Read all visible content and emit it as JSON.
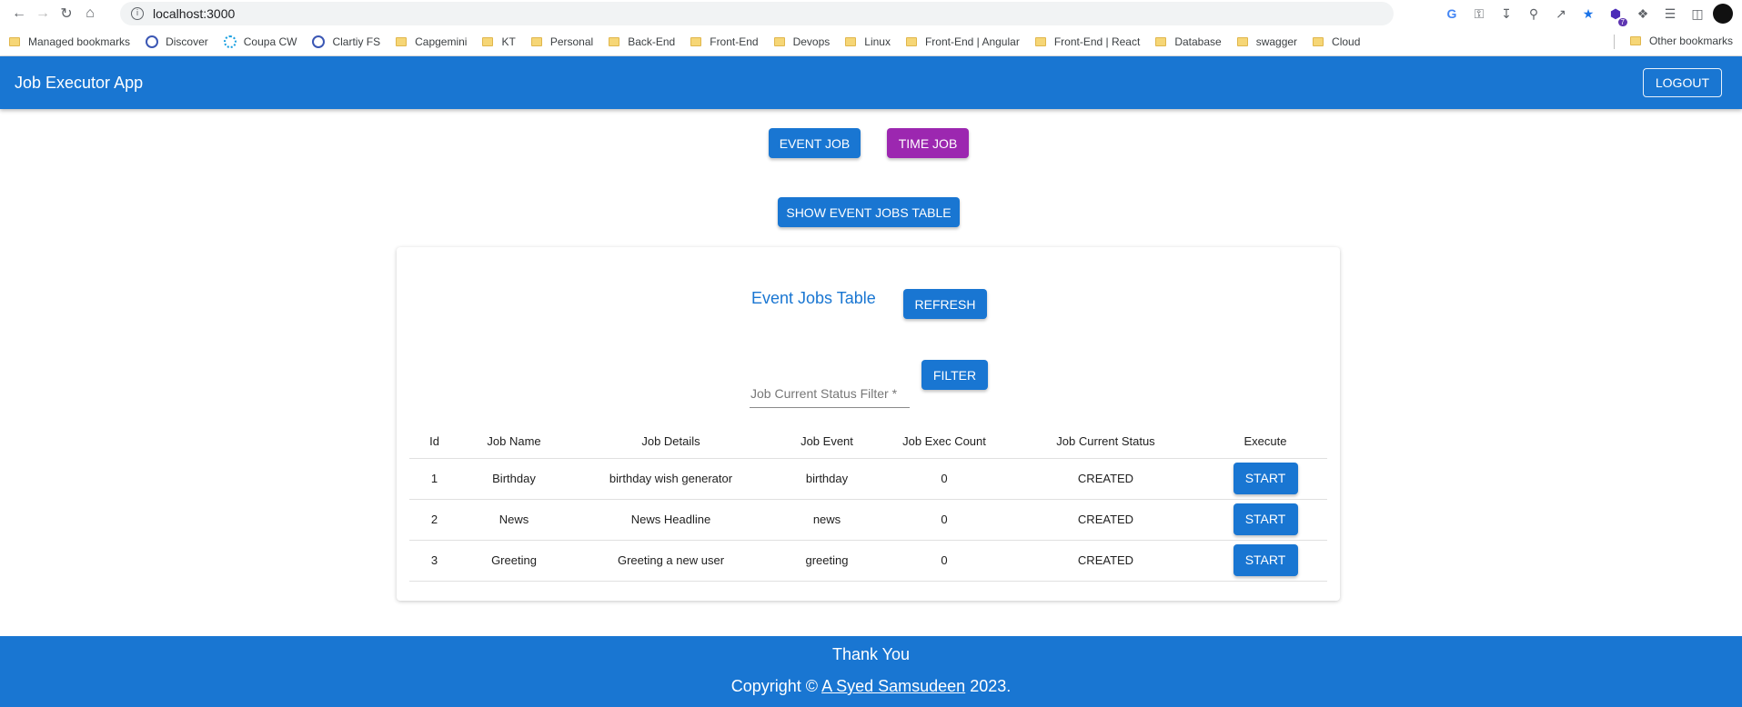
{
  "browser": {
    "url": "localhost:3000",
    "extension_badge": "7",
    "bookmarks": [
      {
        "label": "Managed bookmarks",
        "icon": "folder"
      },
      {
        "label": "Discover",
        "icon": "discover-icon"
      },
      {
        "label": "Coupa CW",
        "icon": "coupa-icon"
      },
      {
        "label": "Clartiy FS",
        "icon": "clarity-icon"
      },
      {
        "label": "Capgemini",
        "icon": "folder"
      },
      {
        "label": "KT",
        "icon": "folder"
      },
      {
        "label": "Personal",
        "icon": "folder"
      },
      {
        "label": "Back-End",
        "icon": "folder"
      },
      {
        "label": "Front-End",
        "icon": "folder"
      },
      {
        "label": "Devops",
        "icon": "folder"
      },
      {
        "label": "Linux",
        "icon": "folder"
      },
      {
        "label": "Front-End | Angular",
        "icon": "folder"
      },
      {
        "label": "Front-End | React",
        "icon": "folder"
      },
      {
        "label": "Database",
        "icon": "folder"
      },
      {
        "label": "swagger",
        "icon": "folder"
      },
      {
        "label": "Cloud",
        "icon": "folder"
      }
    ],
    "other_bookmarks": "Other bookmarks"
  },
  "app": {
    "title": "Job Executor App",
    "logout_label": "LOGOUT",
    "primary_color": "#1976d2",
    "secondary_color": "#9c27b0"
  },
  "actions": {
    "event_job_label": "EVENT JOB",
    "time_job_label": "TIME JOB",
    "show_table_label": "SHOW EVENT JOBS TABLE"
  },
  "card": {
    "title": "Event Jobs Table",
    "refresh_label": "REFRESH",
    "filter_label": "Job Current Status Filter *",
    "filter_button_label": "FILTER"
  },
  "table": {
    "headers": [
      "Id",
      "Job Name",
      "Job Details",
      "Job Event",
      "Job Exec Count",
      "Job Current Status",
      "Execute"
    ],
    "rows": [
      {
        "id": "1",
        "name": "Birthday",
        "details": "birthday wish generator",
        "event": "birthday",
        "count": "0",
        "status": "CREATED",
        "action": "START"
      },
      {
        "id": "2",
        "name": "News",
        "details": "News Headline",
        "event": "news",
        "count": "0",
        "status": "CREATED",
        "action": "START"
      },
      {
        "id": "3",
        "name": "Greeting",
        "details": "Greeting a new user",
        "event": "greeting",
        "count": "0",
        "status": "CREATED",
        "action": "START"
      }
    ]
  },
  "footer": {
    "thanks": "Thank You",
    "copyright_prefix": "Copyright © ",
    "author": "A Syed Samsudeen",
    "copyright_suffix": " 2023."
  }
}
